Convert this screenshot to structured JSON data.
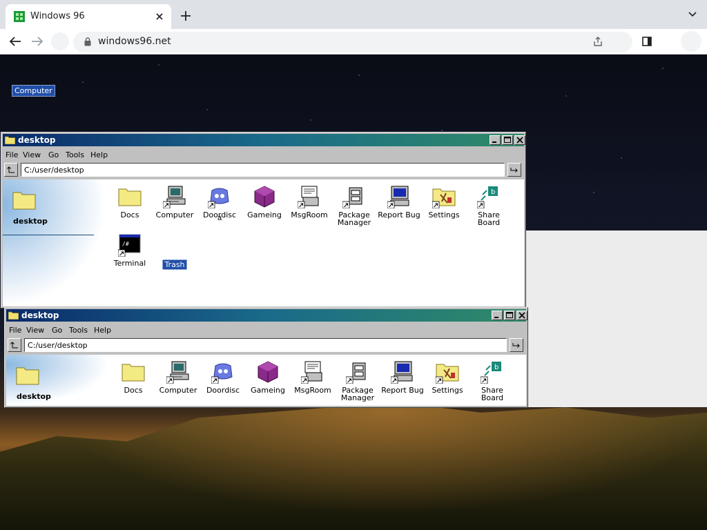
{
  "browser": {
    "tab_title": "Windows 96",
    "url": "windows96.net"
  },
  "desktop": {
    "selected_icon_label": "Computer"
  },
  "window": {
    "title": "desktop",
    "menu": [
      "File",
      "View",
      "Go",
      "Tools",
      "Help"
    ],
    "address": "C:/user/desktop",
    "sidebar_title": "desktop",
    "icons": [
      {
        "label": "Docs",
        "icon": "folder-icon"
      },
      {
        "label": "Computer",
        "icon": "computer-icon"
      },
      {
        "label": "Doordisc",
        "icon": "doordisc-icon"
      },
      {
        "label": "Gameing",
        "icon": "gameing-cube-icon"
      },
      {
        "label": "MsgRoom",
        "icon": "msgroom-icon"
      },
      {
        "label": "Package\nManager",
        "icon": "package-manager-icon"
      },
      {
        "label": "Report Bug",
        "icon": "report-bug-icon"
      },
      {
        "label": "Settings",
        "icon": "settings-icon"
      },
      {
        "label": "Share Board",
        "icon": "share-board-icon"
      },
      {
        "label": "Terminal",
        "icon": "terminal-icon"
      },
      {
        "label": "Trash",
        "icon": "trash-icon"
      }
    ],
    "stray_char": "a"
  },
  "colors": {
    "title_gradient_start": "#0a2a6a",
    "title_gradient_end": "#2f8a66",
    "selection": "#1f4ea8",
    "window_face": "#c0c0c0"
  }
}
